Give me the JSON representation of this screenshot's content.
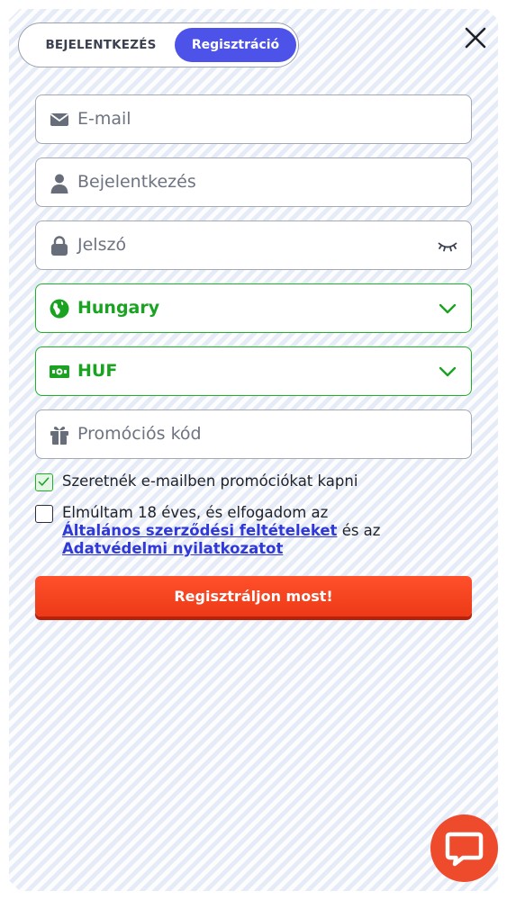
{
  "tabs": {
    "login": "BEJELENTKEZÉS",
    "register": "Regisztráció"
  },
  "form": {
    "email_placeholder": "E-mail",
    "username_placeholder": "Bejelentkezés",
    "password_placeholder": "Jelszó",
    "country": "Hungary",
    "currency": "HUF",
    "promo_placeholder": "Promóciós kód"
  },
  "consent": {
    "newsletter": "Szeretnék e-mailben promóciókat kapni",
    "newsletter_checked": true,
    "terms_prefix": "Elmúltam 18 éves, és elfogadom az",
    "terms_link": "Általános szerződési feltételeket",
    "terms_middle": "és az",
    "privacy_link": "Adatvédelmi nyilatkozatot",
    "terms_checked": false
  },
  "submit_label": "Regisztráljon most!",
  "colors": {
    "accent": "#4d53e8",
    "valid": "#1fb026",
    "cta": "#ee4a2c",
    "link": "#2f38d8"
  },
  "icons": [
    "close-icon",
    "envelope-icon",
    "user-icon",
    "lock-icon",
    "eye-closed-icon",
    "globe-icon",
    "chevron-down-icon",
    "money-icon",
    "gift-icon",
    "checkmark-icon",
    "chat-icon"
  ]
}
